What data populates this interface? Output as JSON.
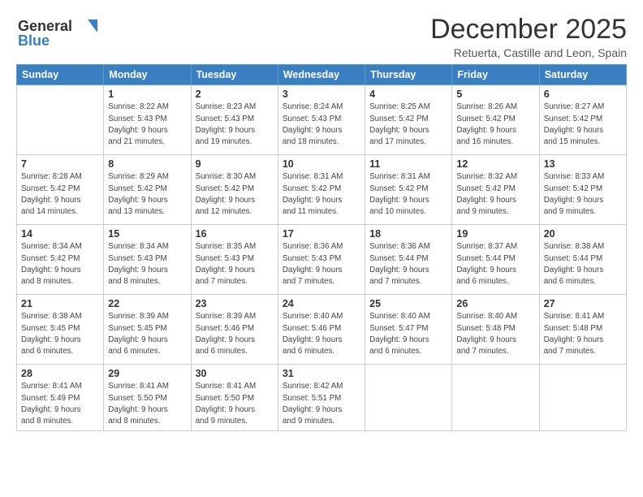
{
  "header": {
    "logo_general": "General",
    "logo_blue": "Blue",
    "month_title": "December 2025",
    "subtitle": "Retuerta, Castille and Leon, Spain"
  },
  "weekdays": [
    "Sunday",
    "Monday",
    "Tuesday",
    "Wednesday",
    "Thursday",
    "Friday",
    "Saturday"
  ],
  "weeks": [
    [
      {
        "day": "",
        "info": ""
      },
      {
        "day": "1",
        "info": "Sunrise: 8:22 AM\nSunset: 5:43 PM\nDaylight: 9 hours\nand 21 minutes."
      },
      {
        "day": "2",
        "info": "Sunrise: 8:23 AM\nSunset: 5:43 PM\nDaylight: 9 hours\nand 19 minutes."
      },
      {
        "day": "3",
        "info": "Sunrise: 8:24 AM\nSunset: 5:43 PM\nDaylight: 9 hours\nand 18 minutes."
      },
      {
        "day": "4",
        "info": "Sunrise: 8:25 AM\nSunset: 5:42 PM\nDaylight: 9 hours\nand 17 minutes."
      },
      {
        "day": "5",
        "info": "Sunrise: 8:26 AM\nSunset: 5:42 PM\nDaylight: 9 hours\nand 16 minutes."
      },
      {
        "day": "6",
        "info": "Sunrise: 8:27 AM\nSunset: 5:42 PM\nDaylight: 9 hours\nand 15 minutes."
      }
    ],
    [
      {
        "day": "7",
        "info": "Sunrise: 8:28 AM\nSunset: 5:42 PM\nDaylight: 9 hours\nand 14 minutes."
      },
      {
        "day": "8",
        "info": "Sunrise: 8:29 AM\nSunset: 5:42 PM\nDaylight: 9 hours\nand 13 minutes."
      },
      {
        "day": "9",
        "info": "Sunrise: 8:30 AM\nSunset: 5:42 PM\nDaylight: 9 hours\nand 12 minutes."
      },
      {
        "day": "10",
        "info": "Sunrise: 8:31 AM\nSunset: 5:42 PM\nDaylight: 9 hours\nand 11 minutes."
      },
      {
        "day": "11",
        "info": "Sunrise: 8:31 AM\nSunset: 5:42 PM\nDaylight: 9 hours\nand 10 minutes."
      },
      {
        "day": "12",
        "info": "Sunrise: 8:32 AM\nSunset: 5:42 PM\nDaylight: 9 hours\nand 9 minutes."
      },
      {
        "day": "13",
        "info": "Sunrise: 8:33 AM\nSunset: 5:42 PM\nDaylight: 9 hours\nand 9 minutes."
      }
    ],
    [
      {
        "day": "14",
        "info": "Sunrise: 8:34 AM\nSunset: 5:42 PM\nDaylight: 9 hours\nand 8 minutes."
      },
      {
        "day": "15",
        "info": "Sunrise: 8:34 AM\nSunset: 5:43 PM\nDaylight: 9 hours\nand 8 minutes."
      },
      {
        "day": "16",
        "info": "Sunrise: 8:35 AM\nSunset: 5:43 PM\nDaylight: 9 hours\nand 7 minutes."
      },
      {
        "day": "17",
        "info": "Sunrise: 8:36 AM\nSunset: 5:43 PM\nDaylight: 9 hours\nand 7 minutes."
      },
      {
        "day": "18",
        "info": "Sunrise: 8:36 AM\nSunset: 5:44 PM\nDaylight: 9 hours\nand 7 minutes."
      },
      {
        "day": "19",
        "info": "Sunrise: 8:37 AM\nSunset: 5:44 PM\nDaylight: 9 hours\nand 6 minutes."
      },
      {
        "day": "20",
        "info": "Sunrise: 8:38 AM\nSunset: 5:44 PM\nDaylight: 9 hours\nand 6 minutes."
      }
    ],
    [
      {
        "day": "21",
        "info": "Sunrise: 8:38 AM\nSunset: 5:45 PM\nDaylight: 9 hours\nand 6 minutes."
      },
      {
        "day": "22",
        "info": "Sunrise: 8:39 AM\nSunset: 5:45 PM\nDaylight: 9 hours\nand 6 minutes."
      },
      {
        "day": "23",
        "info": "Sunrise: 8:39 AM\nSunset: 5:46 PM\nDaylight: 9 hours\nand 6 minutes."
      },
      {
        "day": "24",
        "info": "Sunrise: 8:40 AM\nSunset: 5:46 PM\nDaylight: 9 hours\nand 6 minutes."
      },
      {
        "day": "25",
        "info": "Sunrise: 8:40 AM\nSunset: 5:47 PM\nDaylight: 9 hours\nand 6 minutes."
      },
      {
        "day": "26",
        "info": "Sunrise: 8:40 AM\nSunset: 5:48 PM\nDaylight: 9 hours\nand 7 minutes."
      },
      {
        "day": "27",
        "info": "Sunrise: 8:41 AM\nSunset: 5:48 PM\nDaylight: 9 hours\nand 7 minutes."
      }
    ],
    [
      {
        "day": "28",
        "info": "Sunrise: 8:41 AM\nSunset: 5:49 PM\nDaylight: 9 hours\nand 8 minutes."
      },
      {
        "day": "29",
        "info": "Sunrise: 8:41 AM\nSunset: 5:50 PM\nDaylight: 9 hours\nand 8 minutes."
      },
      {
        "day": "30",
        "info": "Sunrise: 8:41 AM\nSunset: 5:50 PM\nDaylight: 9 hours\nand 9 minutes."
      },
      {
        "day": "31",
        "info": "Sunrise: 8:42 AM\nSunset: 5:51 PM\nDaylight: 9 hours\nand 9 minutes."
      },
      {
        "day": "",
        "info": ""
      },
      {
        "day": "",
        "info": ""
      },
      {
        "day": "",
        "info": ""
      }
    ]
  ]
}
